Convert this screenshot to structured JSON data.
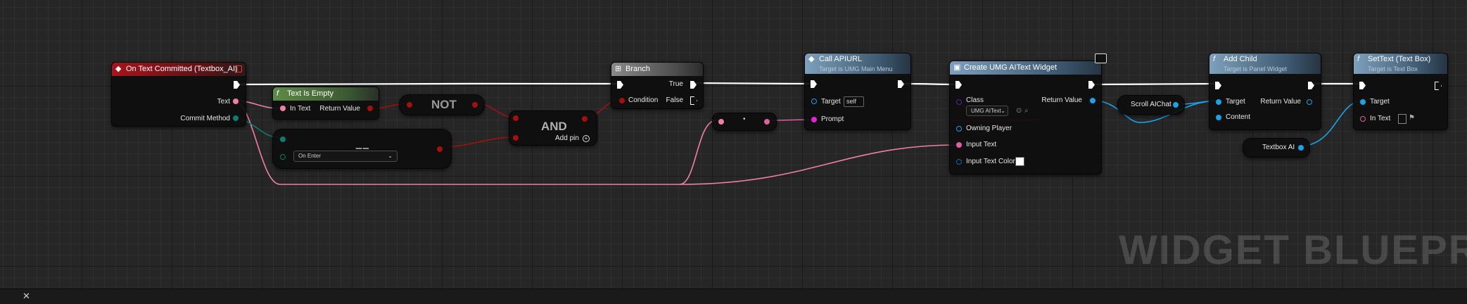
{
  "watermark": "WIDGET BLUEPRINT",
  "colors": {
    "string_pin": "#f07fa8",
    "byte_pin": "#0f7a6d",
    "bool_pin": "#a31010",
    "object_pin": "#1aa3e8",
    "text_pin": "#e25ea0",
    "class_pin": "#5a1eb0",
    "struct_pin": "#0a66c2",
    "exec_pin": "#ffffff"
  },
  "nodes": {
    "on_text_committed": {
      "title": "On Text Committed (Textbox_AI)",
      "pins": {
        "text": "Text",
        "commit_method": "Commit Method"
      }
    },
    "text_is_empty": {
      "title": "Text Is Empty",
      "pins": {
        "in_text": "In Text",
        "return_value": "Return Value"
      }
    },
    "not_node": {
      "label": "NOT"
    },
    "equals_node": {
      "label": "==",
      "dropdown_value": "On Enter"
    },
    "and_node": {
      "label": "AND",
      "add_pin": "Add pin"
    },
    "branch": {
      "title": "Branch",
      "pins": {
        "condition": "Condition",
        "true_label": "True",
        "false_label": "False"
      }
    },
    "call_apiurl": {
      "title": "Call APIURL",
      "subtitle": "Target is UMG Main Menu",
      "pins": {
        "target": "Target",
        "target_value": "self",
        "prompt": "Prompt"
      }
    },
    "create_widget": {
      "title": "Create UMG AIText Widget",
      "pins": {
        "class": "Class",
        "class_value": "UMG AIText",
        "return_value": "Return Value",
        "owning_player": "Owning Player",
        "input_text": "Input Text",
        "input_text_color": "Input Text Color"
      }
    },
    "scroll_aichat": {
      "label": "Scroll AIChat"
    },
    "textbox_ai": {
      "label": "Textbox AI"
    },
    "add_child": {
      "title": "Add Child",
      "subtitle": "Target is Panel Widget",
      "pins": {
        "target": "Target",
        "content": "Content",
        "return_value": "Return Value"
      }
    },
    "set_text": {
      "title": "SetText (Text Box)",
      "subtitle": "Target is Text Box",
      "pins": {
        "target": "Target",
        "in_text": "In Text"
      }
    }
  },
  "bottom_bar": {
    "close_label": "✕"
  }
}
